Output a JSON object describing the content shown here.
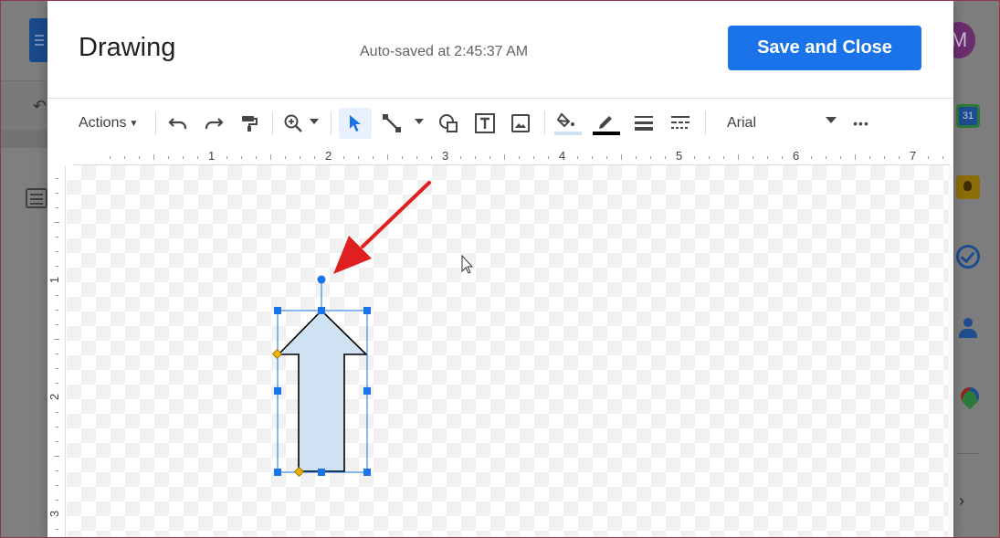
{
  "background": {
    "avatar_letter": "M",
    "calendar_day": "31"
  },
  "dialog": {
    "title": "Drawing",
    "autosave_text": "Auto-saved at 2:45:37 AM",
    "save_close_label": "Save and Close"
  },
  "toolbar": {
    "actions_label": "Actions",
    "font_name": "Arial",
    "more_label": "•••",
    "icons": [
      "undo-icon",
      "redo-icon",
      "paint-format-icon",
      "zoom-icon",
      "select-icon",
      "line-icon",
      "shape-icon",
      "text-box-icon",
      "image-icon",
      "fill-color-icon",
      "border-color-icon",
      "border-weight-icon",
      "border-dash-icon",
      "more-icon"
    ]
  },
  "ruler": {
    "horizontal_labels": [
      "1",
      "2",
      "3",
      "4",
      "5",
      "6",
      "7"
    ],
    "vertical_labels": [
      "1",
      "2",
      "3"
    ]
  },
  "colors": {
    "accent": "#1a73e8",
    "shape_fill": "#cfe2f3",
    "handle_adjust": "#f5b400",
    "annotation_arrow": "#e02020"
  }
}
